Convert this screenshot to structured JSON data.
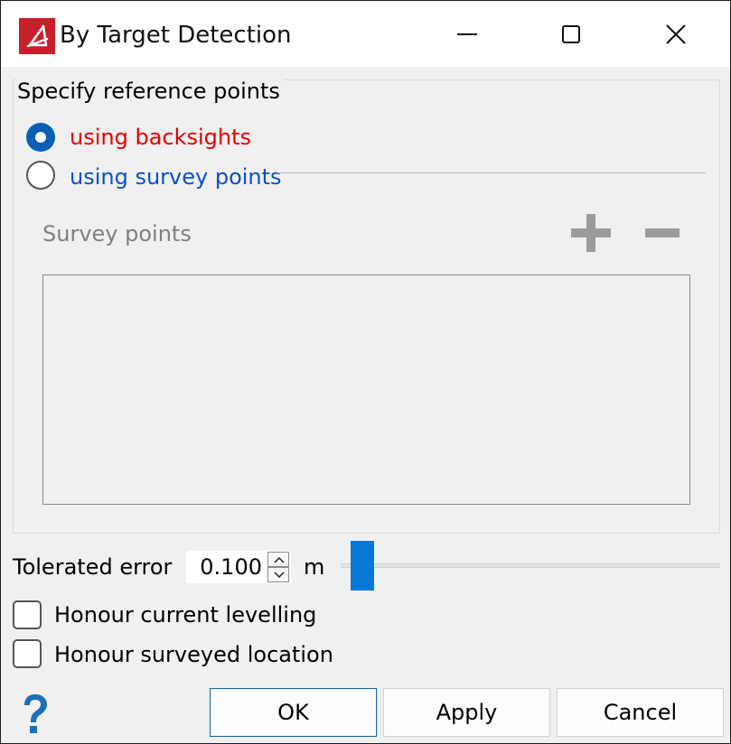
{
  "window": {
    "title": "By Target Detection",
    "icon": "target-detection-app-icon"
  },
  "reference_group": {
    "title": "Specify reference points",
    "options": [
      {
        "label": "using backsights",
        "checked": true,
        "color": "#e60000"
      },
      {
        "label": "using survey points",
        "checked": false,
        "color": "#0a50c8"
      }
    ]
  },
  "survey_points": {
    "title": "Survey points",
    "add_icon": "plus-icon",
    "remove_icon": "minus-icon",
    "items": []
  },
  "tolerance": {
    "label": "Tolerated error",
    "value": "0.100",
    "unit": "m"
  },
  "options": {
    "levelling_label": "Honour current levelling",
    "levelling_checked": false,
    "location_label": "Honour surveyed location",
    "location_checked": false
  },
  "buttons": {
    "ok": "OK",
    "apply": "Apply",
    "cancel": "Cancel"
  },
  "colors": {
    "accent": "#0a5fb4",
    "slider": "#0a78d7",
    "app_icon_bg": "#c8202a",
    "help": "#1a6fb8"
  }
}
